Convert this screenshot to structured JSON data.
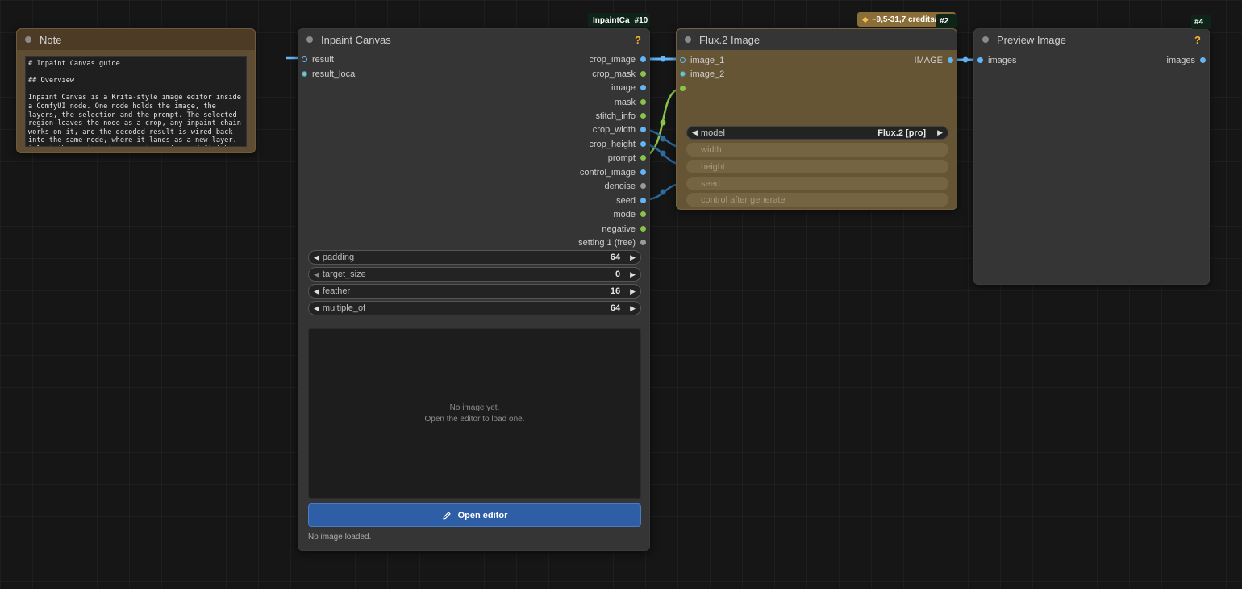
{
  "note": {
    "title": "Note",
    "text": "# Inpaint Canvas guide\n\n## Overview\n\nInpaint Canvas is a Krita-style image editor inside a ComfyUI node. One node holds the image, the layers, the selection and the prompt. The selected region leaves the node as a crop, any inpaint chain works on it, and the decoded result is wired back into the same node, where it lands as a new layer. Select the next spot, generate again, and finish the picture with layers, retouch tools"
  },
  "inpaint": {
    "title": "Inpaint Canvas",
    "badge_name": "InpaintCa",
    "badge_id": "#10",
    "help": "?",
    "inputs": [
      "result",
      "result_local"
    ],
    "outputs": [
      "crop_image",
      "crop_mask",
      "image",
      "mask",
      "stitch_info",
      "crop_width",
      "crop_height",
      "prompt",
      "control_image",
      "denoise",
      "seed",
      "mode",
      "negative",
      "setting 1 (free)"
    ],
    "widgets": [
      {
        "label": "padding",
        "value": "64"
      },
      {
        "label": "target_size",
        "value": "0"
      },
      {
        "label": "feather",
        "value": "16"
      },
      {
        "label": "multiple_of",
        "value": "64"
      }
    ],
    "empty_line1": "No image yet.",
    "empty_line2": "Open the editor to load one.",
    "open_button": "Open editor",
    "status": "No image loaded."
  },
  "flux": {
    "title": "Flux.2 Image",
    "credits": "~9,5-31,7 credits/",
    "badge_id": "#2",
    "inputs": [
      "image_1",
      "image_2"
    ],
    "output": "IMAGE",
    "model_label": "model",
    "model_value": "Flux.2 [pro]",
    "disabled_widgets": [
      "width",
      "height",
      "seed",
      "control after generate"
    ]
  },
  "preview": {
    "title": "Preview Image",
    "badge_id": "#4",
    "help": "?",
    "input": "images",
    "output": "images"
  },
  "colors": {
    "blue_port": "#64b5f6",
    "green_port": "#8bc34a",
    "dark_link": "#2e6b9e",
    "note_bg": "#5e4c33",
    "flux_bg": "#665534",
    "open_button": "#2d5ea6"
  }
}
